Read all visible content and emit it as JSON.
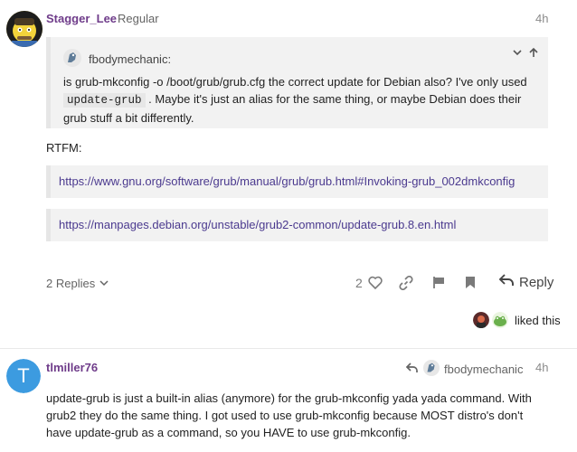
{
  "post1": {
    "username": "Stagger_Lee",
    "user_title": "Regular",
    "time": "4h",
    "quote": {
      "author": "fbodymechanic:",
      "text_before": "is grub-mkconfig -o /boot/grub/grub.cfg the correct update for Debian also? I've only used",
      "code": "update-grub",
      "text_after": ". Maybe it's just an alias for the same thing, or maybe Debian does their grub stuff a bit differently."
    },
    "body": "RTFM:",
    "links": [
      "https://www.gnu.org/software/grub/manual/grub/grub.html#Invoking-grub_002dmkconfig",
      "https://manpages.debian.org/unstable/grub2-common/update-grub.8.en.html"
    ],
    "replies_label": "2 Replies",
    "like_count": "2",
    "reply_label": "Reply",
    "liked_text": "liked this"
  },
  "post2": {
    "username": "tlmiller76",
    "avatar_letter": "T",
    "reply_to": "fbodymechanic",
    "time": "4h",
    "body": "update-grub is just a built-in alias (anymore) for the grub-mkconfig yada yada command. With grub2 they do the same thing. I got used to use grub-mkconfig because MOST distro's don't have update-grub as a command, so you HAVE to use grub-mkconfig."
  },
  "colors": {
    "username": "#6f3c8a",
    "link": "#4b3a8f",
    "avatar_t": "#3c9be0"
  }
}
